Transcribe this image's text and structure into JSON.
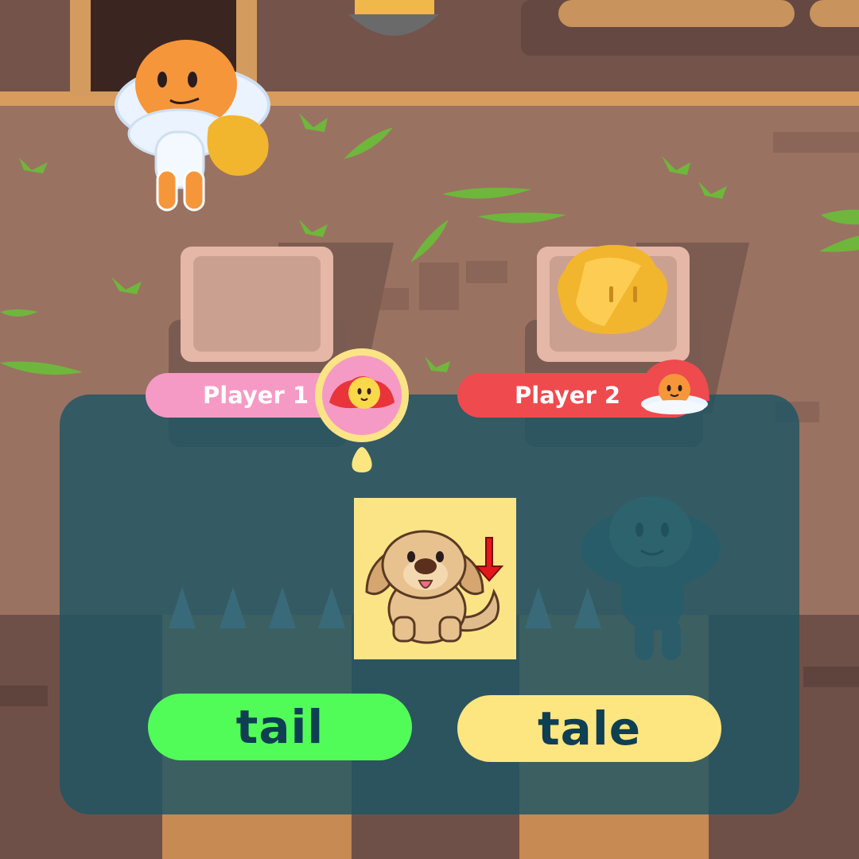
{
  "players": [
    {
      "label": "Player 1",
      "color": "#f59ac4",
      "avatar": "red-hooded-player-icon",
      "active": true
    },
    {
      "label": "Player 2",
      "color": "#ef4a4e",
      "avatar": "orange-cloud-player-icon",
      "active": false
    }
  ],
  "question": {
    "image": "dog-with-tail-arrow-icon"
  },
  "answers": [
    {
      "label": "tail",
      "color": "#52fc58"
    },
    {
      "label": "tale",
      "color": "#fde680"
    }
  ],
  "colors": {
    "overlay": "#1d5564",
    "floor": "#9a7262",
    "wall": "#6f5049",
    "text_dark": "#0f3f52"
  }
}
